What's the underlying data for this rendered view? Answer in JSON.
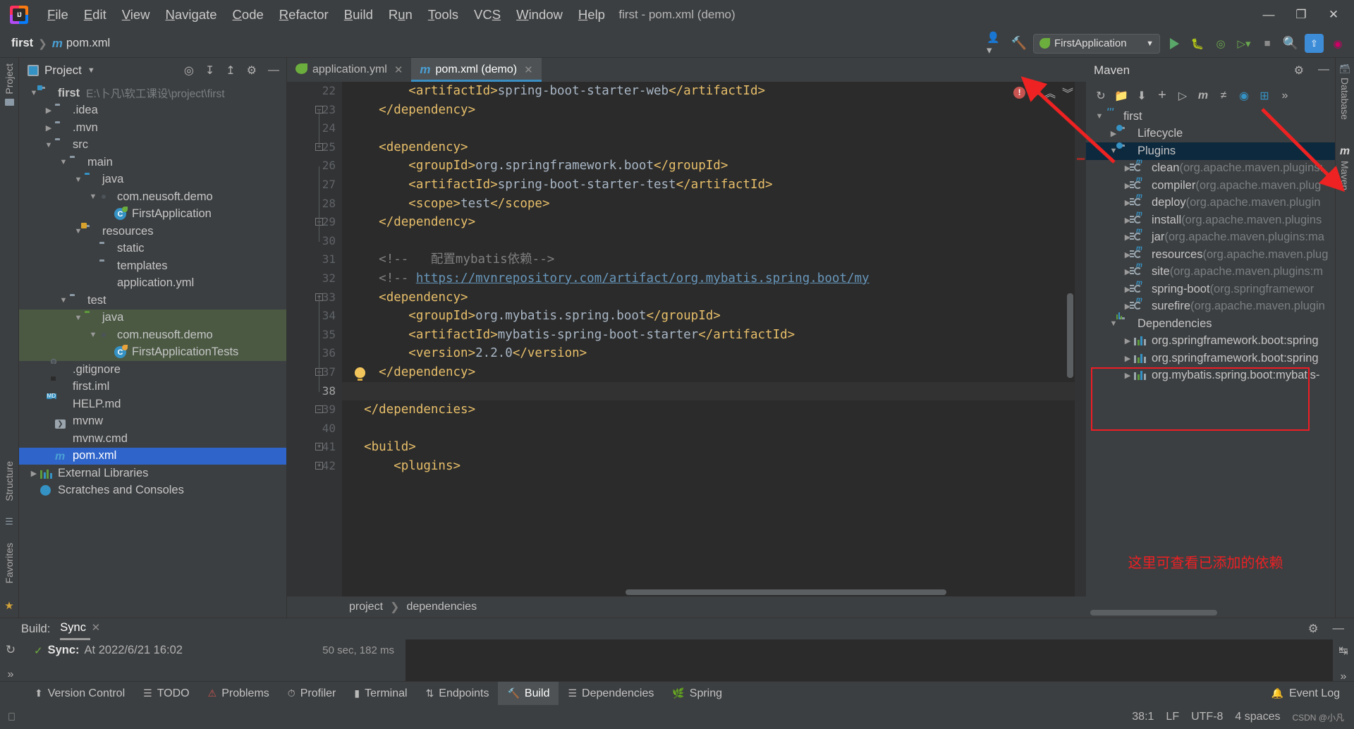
{
  "window": {
    "title": "first - pom.xml (demo)"
  },
  "menu": {
    "items": [
      {
        "label": "File",
        "accel": "F"
      },
      {
        "label": "Edit",
        "accel": "E"
      },
      {
        "label": "View",
        "accel": "V"
      },
      {
        "label": "Navigate",
        "accel": "N"
      },
      {
        "label": "Code",
        "accel": "C"
      },
      {
        "label": "Refactor",
        "accel": "R"
      },
      {
        "label": "Build",
        "accel": "B"
      },
      {
        "label": "Run",
        "accel": "u"
      },
      {
        "label": "Tools",
        "accel": "T"
      },
      {
        "label": "VCS",
        "accel": "S"
      },
      {
        "label": "Window",
        "accel": "W"
      },
      {
        "label": "Help",
        "accel": "H"
      }
    ]
  },
  "window_controls": {
    "minimize": "—",
    "maximize": "❐",
    "close": "✕"
  },
  "navbar": {
    "crumb_project": "first",
    "crumb_file": "pom.xml",
    "run_config": "FirstApplication",
    "icons": [
      "profile-icon",
      "hammer-icon",
      "run-icon",
      "debug-icon",
      "run-with-coverage-icon",
      "profile-run-icon",
      "stop-icon",
      "search-icon",
      "update-icon",
      "ide-icon"
    ]
  },
  "left_rail": {
    "top": "Project",
    "bottom1": "Structure",
    "bottom2": "Favorites"
  },
  "project_panel": {
    "title": "Project",
    "tree": [
      {
        "depth": 0,
        "arrow": "v",
        "icon": "folder-module",
        "label": "first",
        "bold": true,
        "path": "E:\\卜凡\\软工课设\\project\\first"
      },
      {
        "depth": 1,
        "arrow": ">",
        "icon": "folder",
        "label": ".idea"
      },
      {
        "depth": 1,
        "arrow": ">",
        "icon": "folder",
        "label": ".mvn"
      },
      {
        "depth": 1,
        "arrow": "v",
        "icon": "folder",
        "label": "src"
      },
      {
        "depth": 2,
        "arrow": "v",
        "icon": "folder",
        "label": "main"
      },
      {
        "depth": 3,
        "arrow": "v",
        "icon": "folder-source",
        "label": "java"
      },
      {
        "depth": 4,
        "arrow": "v",
        "icon": "package",
        "label": "com.neusoft.demo"
      },
      {
        "depth": 5,
        "arrow": "none",
        "icon": "spring-class",
        "label": "FirstApplication"
      },
      {
        "depth": 3,
        "arrow": "v",
        "icon": "folder-resources",
        "label": "resources"
      },
      {
        "depth": 4,
        "arrow": "none",
        "icon": "folder",
        "label": "static"
      },
      {
        "depth": 4,
        "arrow": "none",
        "icon": "folder",
        "label": "templates"
      },
      {
        "depth": 4,
        "arrow": "none",
        "icon": "yml-file",
        "label": "application.yml"
      },
      {
        "depth": 2,
        "arrow": "v",
        "icon": "folder",
        "label": "test"
      },
      {
        "depth": 3,
        "arrow": "v",
        "icon": "folder-test-source",
        "label": "java",
        "highlight": true
      },
      {
        "depth": 4,
        "arrow": "v",
        "icon": "package",
        "label": "com.neusoft.demo",
        "highlight": true
      },
      {
        "depth": 5,
        "arrow": "none",
        "icon": "test-class",
        "label": "FirstApplicationTests",
        "highlight": true
      },
      {
        "depth": 1,
        "arrow": "none",
        "icon": "gitignore-file",
        "label": ".gitignore"
      },
      {
        "depth": 1,
        "arrow": "none",
        "icon": "iml-file",
        "label": "first.iml"
      },
      {
        "depth": 1,
        "arrow": "none",
        "icon": "md-file",
        "label": "HELP.md"
      },
      {
        "depth": 1,
        "arrow": "none",
        "icon": "script-file",
        "label": "mvnw"
      },
      {
        "depth": 1,
        "arrow": "none",
        "icon": "cmd-file",
        "label": "mvnw.cmd"
      },
      {
        "depth": 1,
        "arrow": "none",
        "icon": "maven-file",
        "label": "pom.xml",
        "selected": true
      },
      {
        "depth": 0,
        "arrow": ">",
        "icon": "libraries",
        "label": "External Libraries"
      },
      {
        "depth": 0,
        "arrow": "none",
        "icon": "scratches",
        "label": "Scratches and Consoles"
      }
    ]
  },
  "editor": {
    "tabs": [
      {
        "label": "application.yml",
        "icon": "yml-file",
        "active": false
      },
      {
        "label": "pom.xml (demo)",
        "icon": "maven-file",
        "active": true
      }
    ],
    "first_line_number": 22,
    "lines": [
      {
        "n": 22,
        "segs": [
          {
            "t": "        ",
            "c": "tx"
          },
          {
            "t": "<artifactId>",
            "c": "tg"
          },
          {
            "t": "spring-boot-starter-web",
            "c": "tx"
          },
          {
            "t": "</artifactId>",
            "c": "tg"
          }
        ]
      },
      {
        "n": 23,
        "segs": [
          {
            "t": "    ",
            "c": "tx"
          },
          {
            "t": "</dependency>",
            "c": "tg"
          }
        ],
        "fold": "minus"
      },
      {
        "n": 24,
        "segs": []
      },
      {
        "n": 25,
        "segs": [
          {
            "t": "    ",
            "c": "tx"
          },
          {
            "t": "<dependency>",
            "c": "tg"
          }
        ],
        "fold": "plus"
      },
      {
        "n": 26,
        "segs": [
          {
            "t": "        ",
            "c": "tx"
          },
          {
            "t": "<groupId>",
            "c": "tg"
          },
          {
            "t": "org.springframework.boot",
            "c": "tx"
          },
          {
            "t": "</groupId>",
            "c": "tg"
          }
        ]
      },
      {
        "n": 27,
        "segs": [
          {
            "t": "        ",
            "c": "tx"
          },
          {
            "t": "<artifactId>",
            "c": "tg"
          },
          {
            "t": "spring-boot-starter-test",
            "c": "tx"
          },
          {
            "t": "</artifactId>",
            "c": "tg"
          }
        ]
      },
      {
        "n": 28,
        "segs": [
          {
            "t": "        ",
            "c": "tx"
          },
          {
            "t": "<scope>",
            "c": "tg"
          },
          {
            "t": "test",
            "c": "tx"
          },
          {
            "t": "</scope>",
            "c": "tg"
          }
        ]
      },
      {
        "n": 29,
        "segs": [
          {
            "t": "    ",
            "c": "tx"
          },
          {
            "t": "</dependency>",
            "c": "tg"
          }
        ],
        "fold": "minus"
      },
      {
        "n": 30,
        "segs": []
      },
      {
        "n": 31,
        "segs": [
          {
            "t": "    ",
            "c": "tx"
          },
          {
            "t": "<!--   配置mybatis依赖-->",
            "c": "cm"
          }
        ]
      },
      {
        "n": 32,
        "segs": [
          {
            "t": "    ",
            "c": "tx"
          },
          {
            "t": "<!-- ",
            "c": "cm"
          },
          {
            "t": "https://mvnrepository.com/artifact/org.mybatis.spring.boot/my",
            "c": "lnk"
          }
        ]
      },
      {
        "n": 33,
        "segs": [
          {
            "t": "    ",
            "c": "tx"
          },
          {
            "t": "<dependency>",
            "c": "tg"
          }
        ],
        "fold": "plus"
      },
      {
        "n": 34,
        "segs": [
          {
            "t": "        ",
            "c": "tx"
          },
          {
            "t": "<groupId>",
            "c": "tg"
          },
          {
            "t": "org.mybatis.spring.boot",
            "c": "tx"
          },
          {
            "t": "</groupId>",
            "c": "tg"
          }
        ]
      },
      {
        "n": 35,
        "segs": [
          {
            "t": "        ",
            "c": "tx"
          },
          {
            "t": "<artifactId>",
            "c": "tg"
          },
          {
            "t": "mybatis-spring-boot-starter",
            "c": "tx"
          },
          {
            "t": "</artifactId>",
            "c": "tg"
          }
        ]
      },
      {
        "n": 36,
        "segs": [
          {
            "t": "        ",
            "c": "tx"
          },
          {
            "t": "<version>",
            "c": "tg"
          },
          {
            "t": "2.2.0",
            "c": "tx"
          },
          {
            "t": "</version>",
            "c": "tg"
          }
        ]
      },
      {
        "n": 37,
        "segs": [
          {
            "t": "    ",
            "c": "tx"
          },
          {
            "t": "</dependency>",
            "c": "tg"
          }
        ],
        "fold": "minus",
        "bulb": true
      },
      {
        "n": 38,
        "segs": [],
        "current": true
      },
      {
        "n": 39,
        "segs": [
          {
            "t": "  ",
            "c": "tx"
          },
          {
            "t": "</dependencies>",
            "c": "tg"
          }
        ],
        "fold": "minus"
      },
      {
        "n": 40,
        "segs": []
      },
      {
        "n": 41,
        "segs": [
          {
            "t": "  ",
            "c": "tx"
          },
          {
            "t": "<build>",
            "c": "tg"
          }
        ],
        "fold": "plus"
      },
      {
        "n": 42,
        "segs": [
          {
            "t": "      ",
            "c": "tx"
          },
          {
            "t": "<plugins>",
            "c": "tg"
          }
        ],
        "fold": "plus"
      }
    ],
    "inspection_count": "1",
    "breadcrumb": [
      "project",
      "dependencies"
    ]
  },
  "maven_panel": {
    "title": "Maven",
    "toolbar_icons": [
      "reload-icon",
      "add-folder-icon",
      "download-icon",
      "plus-icon",
      "run-icon",
      "maven-goal-icon",
      "skip-tests-icon",
      "toggle-offline-icon",
      "expand-icon",
      "more-icon"
    ],
    "settings_icon": "gear-icon",
    "collapse_icon": "minimize-icon",
    "tree": [
      {
        "depth": 0,
        "arrow": "v",
        "icon": "maven-project",
        "label": "first"
      },
      {
        "depth": 1,
        "arrow": ">",
        "icon": "folder-gear",
        "label": "Lifecycle"
      },
      {
        "depth": 1,
        "arrow": "v",
        "icon": "folder-gear",
        "label": "Plugins",
        "selected": true
      },
      {
        "depth": 2,
        "arrow": ">",
        "icon": "plugin",
        "label": "clean",
        "detail": "(org.apache.maven.plugins:"
      },
      {
        "depth": 2,
        "arrow": ">",
        "icon": "plugin",
        "label": "compiler",
        "detail": "(org.apache.maven.plug"
      },
      {
        "depth": 2,
        "arrow": ">",
        "icon": "plugin",
        "label": "deploy",
        "detail": "(org.apache.maven.plugin"
      },
      {
        "depth": 2,
        "arrow": ">",
        "icon": "plugin",
        "label": "install",
        "detail": "(org.apache.maven.plugins"
      },
      {
        "depth": 2,
        "arrow": ">",
        "icon": "plugin",
        "label": "jar",
        "detail": "(org.apache.maven.plugins:ma"
      },
      {
        "depth": 2,
        "arrow": ">",
        "icon": "plugin",
        "label": "resources",
        "detail": "(org.apache.maven.plug"
      },
      {
        "depth": 2,
        "arrow": ">",
        "icon": "plugin",
        "label": "site",
        "detail": "(org.apache.maven.plugins:m"
      },
      {
        "depth": 2,
        "arrow": ">",
        "icon": "plugin",
        "label": "spring-boot",
        "detail": "(org.springframewor"
      },
      {
        "depth": 2,
        "arrow": ">",
        "icon": "plugin",
        "label": "surefire",
        "detail": "(org.apache.maven.plugin"
      },
      {
        "depth": 1,
        "arrow": "v",
        "icon": "dependencies",
        "label": "Dependencies"
      },
      {
        "depth": 2,
        "arrow": ">",
        "icon": "dependency",
        "label": "org.springframework.boot:spring"
      },
      {
        "depth": 2,
        "arrow": ">",
        "icon": "dependency",
        "label": "org.springframework.boot:spring"
      },
      {
        "depth": 2,
        "arrow": ">",
        "icon": "dependency",
        "label": "org.mybatis.spring.boot:mybatis-"
      }
    ],
    "annotation": "这里可查看已添加的依赖",
    "annotation_color": "#ed2024"
  },
  "right_rail": {
    "database": "Database",
    "maven": "Maven"
  },
  "build_panel": {
    "label": "Build:",
    "tab": "Sync",
    "status_label": "Sync:",
    "status_detail": "At 2022/6/21 16:02",
    "duration": "50 sec, 182 ms",
    "settings_icon": "gear-icon",
    "minimize_icon": "minimize-icon"
  },
  "toolwindows": {
    "items": [
      {
        "label": "Version Control",
        "icon": "branch-icon",
        "active": false
      },
      {
        "label": "TODO",
        "icon": "list-icon",
        "active": false
      },
      {
        "label": "Problems",
        "icon": "error-icon",
        "active": false
      },
      {
        "label": "Profiler",
        "icon": "profiler-icon",
        "active": false
      },
      {
        "label": "Terminal",
        "icon": "terminal-icon",
        "active": false
      },
      {
        "label": "Endpoints",
        "icon": "endpoints-icon",
        "active": false
      },
      {
        "label": "Build",
        "icon": "hammer-icon",
        "active": true
      },
      {
        "label": "Dependencies",
        "icon": "dependencies-icon",
        "active": false
      },
      {
        "label": "Spring",
        "icon": "spring-icon",
        "active": false
      }
    ],
    "event_log": "Event Log"
  },
  "statusbar": {
    "caret": "38:1",
    "line_sep": "LF",
    "encoding": "UTF-8",
    "indent": "4 spaces",
    "extra": "CSDN @小凡"
  }
}
